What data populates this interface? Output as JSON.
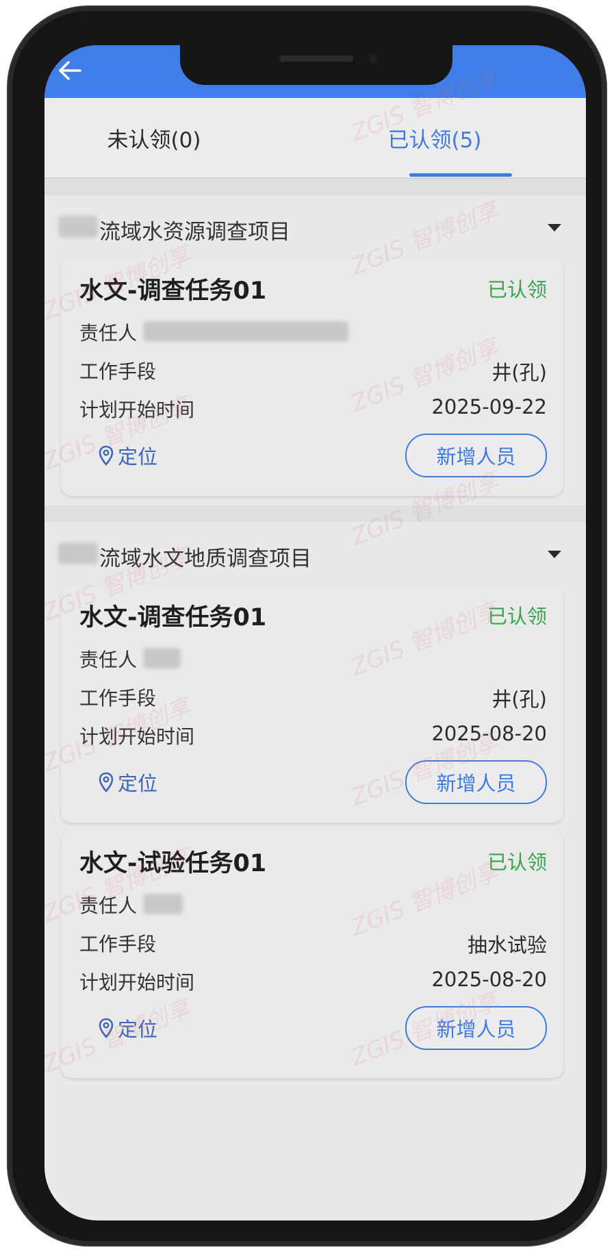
{
  "header": {
    "back_icon": "arrow-left-icon"
  },
  "tabs": [
    {
      "label": "未认领(0)",
      "active": false
    },
    {
      "label": "已认领(5)",
      "active": true
    }
  ],
  "colors": {
    "accent": "#3d7be0",
    "appbar": "#3f7ee8",
    "status_green": "#3aa44c"
  },
  "projects": [
    {
      "title": "流域水资源调查项目",
      "tasks": [
        {
          "name": "水文-调查任务01",
          "status": "已认领",
          "owner_label": "责任人",
          "method_label": "工作手段",
          "method": "井(孔)",
          "start_label": "计划开始时间",
          "start_date": "2025-09-22",
          "locate_label": "定位",
          "add_label": "新增人员"
        }
      ]
    },
    {
      "title": "流域水文地质调查项目",
      "tasks": [
        {
          "name": "水文-调查任务01",
          "status": "已认领",
          "owner_label": "责任人",
          "method_label": "工作手段",
          "method": "井(孔)",
          "start_label": "计划开始时间",
          "start_date": "2025-08-20",
          "locate_label": "定位",
          "add_label": "新增人员"
        },
        {
          "name": "水文-试验任务01",
          "status": "已认领",
          "owner_label": "责任人",
          "method_label": "工作手段",
          "method": "抽水试验",
          "start_label": "计划开始时间",
          "start_date": "2025-08-20",
          "locate_label": "定位",
          "add_label": "新增人员"
        }
      ]
    }
  ],
  "watermark": "ZGIS 智博创享"
}
